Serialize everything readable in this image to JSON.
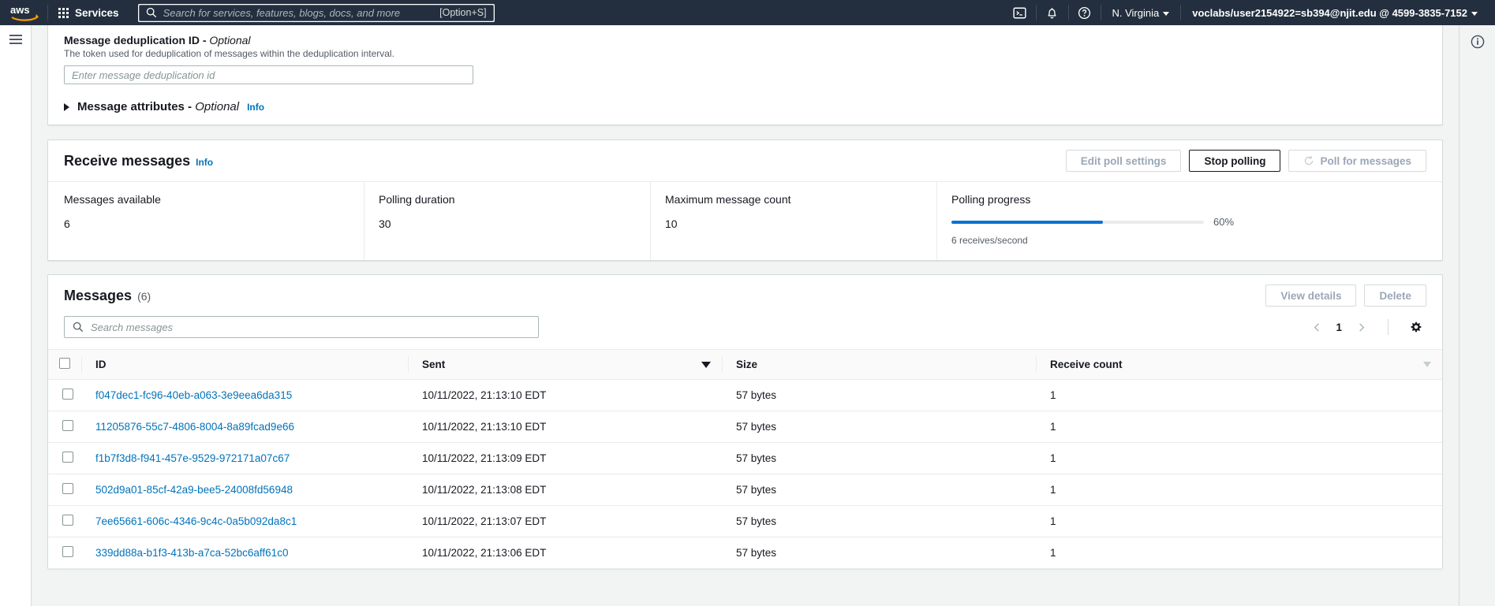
{
  "topnav": {
    "logo_alt": "aws",
    "services_label": "Services",
    "search_placeholder": "Search for services, features, blogs, docs, and more",
    "search_value": "",
    "search_shortcut": "[Option+S]",
    "cloudshell_label": "cloudshell-icon",
    "notifications_label": "bell-icon",
    "help_label": "help-icon",
    "region_label": "N. Virginia",
    "account_label": "voclabs/user2154922=sb394@njit.edu @ 4599-3835-7152"
  },
  "dedup_section": {
    "label": "Message deduplication ID - ",
    "label_optional": "Optional",
    "description": "The token used for deduplication of messages within the deduplication interval.",
    "input_placeholder": "Enter message deduplication id",
    "input_value": ""
  },
  "attributes_section": {
    "title": "Message attributes - ",
    "title_optional": "Optional",
    "info_label": "Info"
  },
  "receive_messages": {
    "title": "Receive messages",
    "info_label": "Info",
    "buttons": {
      "edit_poll_settings": "Edit poll settings",
      "stop_polling": "Stop polling",
      "poll_for_messages": "Poll for messages"
    },
    "metrics": [
      {
        "label": "Messages available",
        "value": "6"
      },
      {
        "label": "Polling duration",
        "value": "30"
      },
      {
        "label": "Maximum message count",
        "value": "10"
      }
    ],
    "progress": {
      "label": "Polling progress",
      "percent_label": "60%",
      "percent_value": 60,
      "sub_label": "6 receives/second",
      "fill_color": "#0972d3"
    }
  },
  "messages_panel": {
    "title": "Messages",
    "count_label": "(6)",
    "buttons": {
      "view_details": "View details",
      "delete": "Delete"
    },
    "search_placeholder": "Search messages",
    "search_value": "",
    "pagination": {
      "prev_label": "chevron-left-icon",
      "page": "1",
      "next_label": "chevron-right-icon",
      "settings_label": "gear-icon"
    },
    "columns": [
      {
        "key": "id",
        "label": "ID",
        "sort": "none"
      },
      {
        "key": "sent",
        "label": "Sent",
        "sort": "desc-active"
      },
      {
        "key": "size",
        "label": "Size",
        "sort": "none"
      },
      {
        "key": "receive_count",
        "label": "Receive count",
        "sort": "desc-idle"
      }
    ],
    "rows": [
      {
        "id": "f047dec1-fc96-40eb-a063-3e9eea6da315",
        "sent": "10/11/2022, 21:13:10 EDT",
        "size": "57 bytes",
        "receive_count": "1",
        "selected": false
      },
      {
        "id": "11205876-55c7-4806-8004-8a89fcad9e66",
        "sent": "10/11/2022, 21:13:10 EDT",
        "size": "57 bytes",
        "receive_count": "1",
        "selected": false
      },
      {
        "id": "f1b7f3d8-f941-457e-9529-972171a07c67",
        "sent": "10/11/2022, 21:13:09 EDT",
        "size": "57 bytes",
        "receive_count": "1",
        "selected": false
      },
      {
        "id": "502d9a01-85cf-42a9-bee5-24008fd56948",
        "sent": "10/11/2022, 21:13:08 EDT",
        "size": "57 bytes",
        "receive_count": "1",
        "selected": false
      },
      {
        "id": "7ee65661-606c-4346-9c4c-0a5b092da8c1",
        "sent": "10/11/2022, 21:13:07 EDT",
        "size": "57 bytes",
        "receive_count": "1",
        "selected": false
      },
      {
        "id": "339dd88a-b1f3-413b-a7ca-52bc6aff61c0",
        "sent": "10/11/2022, 21:13:06 EDT",
        "size": "57 bytes",
        "receive_count": "1",
        "selected": false
      }
    ]
  },
  "rails": {
    "menu_label": "hamburger-menu-icon",
    "info_panel_label": "info-circle-icon"
  },
  "colors": {
    "nav_bg": "#232f3e",
    "link": "#0073bb",
    "accent": "#0972d3",
    "page_bg": "#f2f3f3"
  }
}
